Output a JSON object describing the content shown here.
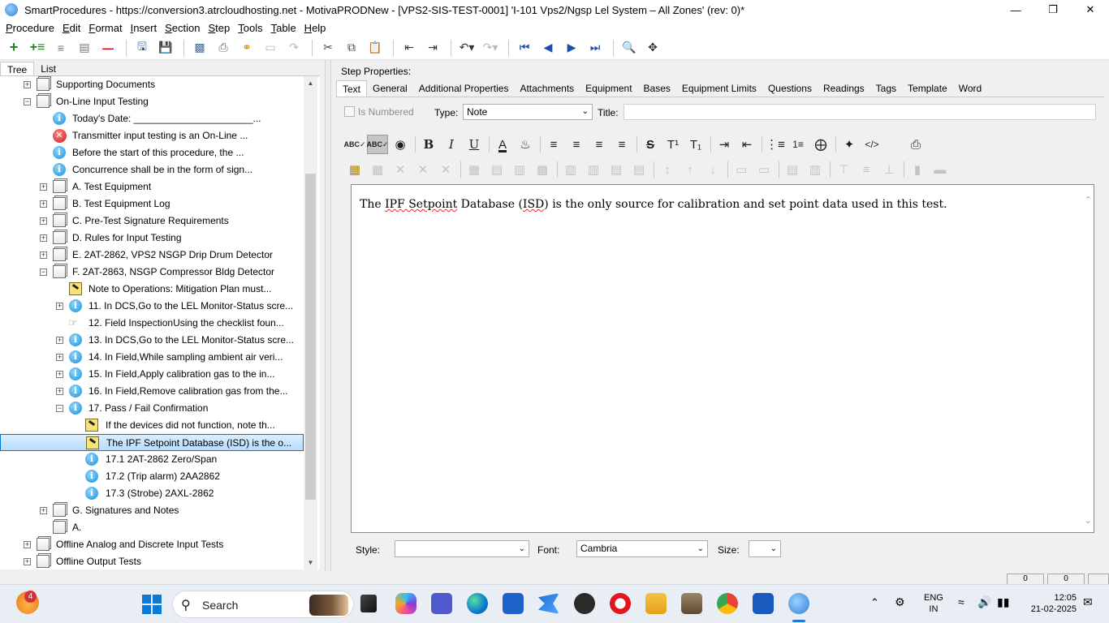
{
  "window": {
    "title": "SmartProcedures - https://conversion3.atrcloudhosting.net - MotivaPRODNew - [VPS2-SIS-TEST-0001] 'I-101 Vps2/Ngsp Lel System – All Zones' (rev: 0)*",
    "controls": [
      "—",
      "❐",
      "✕"
    ]
  },
  "menu": [
    "Procedure",
    "Edit",
    "Format",
    "Insert",
    "Section",
    "Step",
    "Tools",
    "Table",
    "Help"
  ],
  "left_panel": {
    "tabs": [
      "Tree",
      "List"
    ],
    "tree": [
      {
        "level": 1,
        "expander": "+",
        "icon": "doc",
        "label": "Supporting Documents"
      },
      {
        "level": 1,
        "expander": "−",
        "icon": "doc",
        "label": "On-Line Input Testing"
      },
      {
        "level": 2,
        "expander": "",
        "icon": "info",
        "label": "Today's Date: ______________________..."
      },
      {
        "level": 2,
        "expander": "",
        "icon": "error",
        "label": "Transmitter input testing is an On-Line ..."
      },
      {
        "level": 2,
        "expander": "",
        "icon": "info",
        "label": "Before the start of this procedure, the ..."
      },
      {
        "level": 2,
        "expander": "",
        "icon": "info",
        "label": "Concurrence shall be in the form of sign..."
      },
      {
        "level": 2,
        "expander": "+",
        "icon": "doc",
        "label": "A. Test Equipment"
      },
      {
        "level": 2,
        "expander": "+",
        "icon": "doc",
        "label": "B. Test Equipment Log"
      },
      {
        "level": 2,
        "expander": "+",
        "icon": "doc",
        "label": "C. Pre-Test Signature Requirements"
      },
      {
        "level": 2,
        "expander": "+",
        "icon": "doc",
        "label": "D. Rules for Input Testing"
      },
      {
        "level": 2,
        "expander": "+",
        "icon": "doc",
        "label": "E. 2AT-2862, VPS2 NSGP Drip Drum Detector"
      },
      {
        "level": 2,
        "expander": "−",
        "icon": "doc",
        "label": "F. 2AT-2863, NSGP Compressor Bldg Detector"
      },
      {
        "level": 3,
        "expander": "",
        "icon": "note",
        "label": "Note to Operations: Mitigation Plan must..."
      },
      {
        "level": 3,
        "expander": "+",
        "icon": "info",
        "label": "11. In DCS,Go to the LEL Monitor-Status scre..."
      },
      {
        "level": 3,
        "expander": "",
        "icon": "hand",
        "label": "12. Field InspectionUsing the checklist foun..."
      },
      {
        "level": 3,
        "expander": "+",
        "icon": "info",
        "label": "13. In DCS,Go to the LEL Monitor-Status scre..."
      },
      {
        "level": 3,
        "expander": "+",
        "icon": "info",
        "label": "14. In Field,While sampling ambient air veri..."
      },
      {
        "level": 3,
        "expander": "+",
        "icon": "info",
        "label": "15. In Field,Apply calibration gas to the in..."
      },
      {
        "level": 3,
        "expander": "+",
        "icon": "info",
        "label": "16. In Field,Remove calibration gas from the..."
      },
      {
        "level": 3,
        "expander": "−",
        "icon": "info",
        "label": "17. Pass / Fail Confirmation"
      },
      {
        "level": 4,
        "expander": "",
        "icon": "note",
        "label": "If the devices did not function, note th..."
      },
      {
        "level": 4,
        "expander": "",
        "icon": "note",
        "label": "The IPF Setpoint Database (ISD) is the o...",
        "selected": true
      },
      {
        "level": 4,
        "expander": "",
        "icon": "info",
        "label": "17.1 2AT-2862 Zero/Span"
      },
      {
        "level": 4,
        "expander": "",
        "icon": "info",
        "label": "17.2 (Trip alarm) 2AA2862"
      },
      {
        "level": 4,
        "expander": "",
        "icon": "info",
        "label": "17.3 (Strobe) 2AXL-2862"
      },
      {
        "level": 2,
        "expander": "+",
        "icon": "doc",
        "label": "G. Signatures and Notes"
      },
      {
        "level": 2,
        "expander": "",
        "icon": "doc",
        "label": "A."
      },
      {
        "level": 1,
        "expander": "+",
        "icon": "doc",
        "label": "Offline Analog and Discrete Input Tests"
      },
      {
        "level": 1,
        "expander": "+",
        "icon": "doc",
        "label": "Offline Output Tests"
      }
    ]
  },
  "step_properties": {
    "heading": "Step Properties:",
    "tabs": [
      "Text",
      "General",
      "Additional Properties",
      "Attachments",
      "Equipment",
      "Bases",
      "Equipment Limits",
      "Questions",
      "Readings",
      "Tags",
      "Template",
      "Word"
    ],
    "active_tab": "Text",
    "is_numbered_label": "Is Numbered",
    "type_label": "Type:",
    "type_value": "Note",
    "title_label": "Title:",
    "title_value": "",
    "editor_text": {
      "before": "The ",
      "spell1": "IPF Setpoint",
      "middle": " Database (",
      "spell2": "ISD",
      "after": ") is the only source for calibration and set point data used in this test."
    },
    "style_label": "Style:",
    "style_value": "",
    "font_label": "Font:",
    "font_value": "Cambria",
    "size_label": "Size:",
    "size_value": ""
  },
  "status": {
    "box1": "0",
    "box2": "0"
  },
  "taskbar": {
    "weather_badge": "4",
    "search_label": "Search",
    "lang_line1": "ENG",
    "lang_line2": "IN",
    "time": "12:05",
    "date": "21-02-2025"
  },
  "colors": {
    "selection": "#cce8ff",
    "accent": "#0078d7",
    "info_blue": "#1a8fd6",
    "error_red": "#d11a1a"
  }
}
